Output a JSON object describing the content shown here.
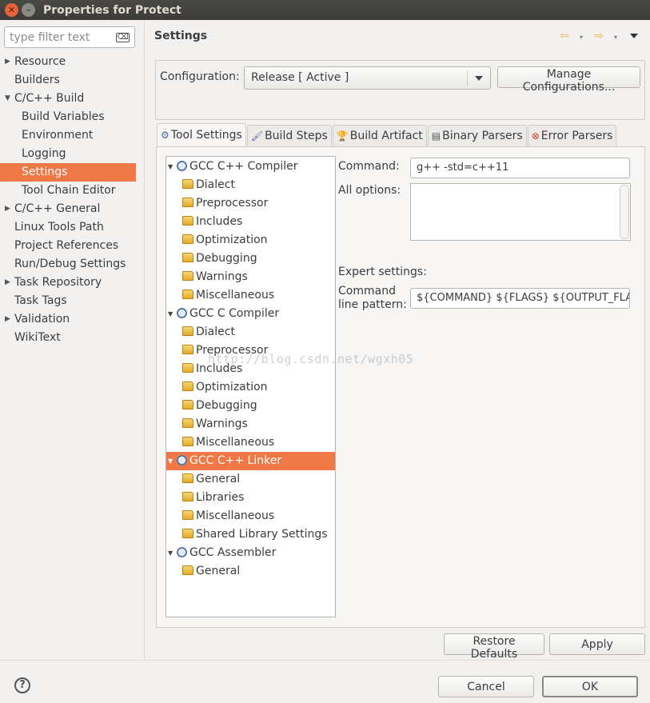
{
  "window": {
    "title": "Properties for Protect",
    "close_glyph": "✕",
    "minimize_glyph": "–"
  },
  "filter": {
    "placeholder": "type filter text",
    "clear_glyph": "⌫"
  },
  "nav": {
    "items": [
      {
        "label": "Resource",
        "expandable": true
      },
      {
        "label": "Builders"
      },
      {
        "label": "C/C++ Build",
        "expanded": true
      },
      {
        "label": "Build Variables",
        "child": true
      },
      {
        "label": "Environment",
        "child": true
      },
      {
        "label": "Logging",
        "child": true
      },
      {
        "label": "Settings",
        "child": true,
        "selected": true
      },
      {
        "label": "Tool Chain Editor",
        "child": true
      },
      {
        "label": "C/C++ General",
        "expandable": true
      },
      {
        "label": "Linux Tools Path"
      },
      {
        "label": "Project References"
      },
      {
        "label": "Run/Debug Settings"
      },
      {
        "label": "Task Repository",
        "expandable": true
      },
      {
        "label": "Task Tags"
      },
      {
        "label": "Validation",
        "expandable": true
      },
      {
        "label": "WikiText"
      }
    ]
  },
  "header": {
    "title": "Settings",
    "back_icon": "⇦",
    "forward_icon": "⇨",
    "dropdown_glyph": "▾"
  },
  "config": {
    "label": "Configuration:",
    "selected": "Release  [ Active ]",
    "manage_button": "Manage Configurations..."
  },
  "tabs": [
    {
      "label": "Tool Settings",
      "icon": "gear-icon",
      "active": true
    },
    {
      "label": "Build Steps",
      "icon": "brush-icon"
    },
    {
      "label": "Build Artifact",
      "icon": "trophy-icon"
    },
    {
      "label": "Binary Parsers",
      "icon": "binary-icon"
    },
    {
      "label": "Error Parsers",
      "icon": "error-icon"
    }
  ],
  "tab_glyphs": {
    "gear": "⚙",
    "brush": "🖌",
    "trophy": "🏆",
    "binary": "▤",
    "error": "⊗"
  },
  "tree": [
    {
      "label": "GCC C++ Compiler",
      "type": "tool"
    },
    {
      "label": "Dialect",
      "type": "option"
    },
    {
      "label": "Preprocessor",
      "type": "option"
    },
    {
      "label": "Includes",
      "type": "option"
    },
    {
      "label": "Optimization",
      "type": "option"
    },
    {
      "label": "Debugging",
      "type": "option"
    },
    {
      "label": "Warnings",
      "type": "option"
    },
    {
      "label": "Miscellaneous",
      "type": "option"
    },
    {
      "label": "GCC C Compiler",
      "type": "tool"
    },
    {
      "label": "Dialect",
      "type": "option"
    },
    {
      "label": "Preprocessor",
      "type": "option"
    },
    {
      "label": "Includes",
      "type": "option"
    },
    {
      "label": "Optimization",
      "type": "option"
    },
    {
      "label": "Debugging",
      "type": "option"
    },
    {
      "label": "Warnings",
      "type": "option"
    },
    {
      "label": "Miscellaneous",
      "type": "option"
    },
    {
      "label": "GCC C++ Linker",
      "type": "tool",
      "selected": true
    },
    {
      "label": "General",
      "type": "option"
    },
    {
      "label": "Libraries",
      "type": "option"
    },
    {
      "label": "Miscellaneous",
      "type": "option"
    },
    {
      "label": "Shared Library Settings",
      "type": "option"
    },
    {
      "label": "GCC Assembler",
      "type": "tool"
    },
    {
      "label": "General",
      "type": "option"
    }
  ],
  "tool_form": {
    "command_label": "Command:",
    "command_value": "g++ -std=c++11",
    "all_options_label": "All options:",
    "all_options_value": "",
    "expert_label": "Expert settings:",
    "pattern_label_1": "Command",
    "pattern_label_2": "line pattern:",
    "pattern_value": "${COMMAND} ${FLAGS} ${OUTPUT_FLA"
  },
  "watermark": "http://blog.csdn.net/wgxh05",
  "buttons": {
    "restore_defaults": "Restore Defaults",
    "apply": "Apply",
    "cancel": "Cancel",
    "ok": "OK",
    "help": "?"
  }
}
